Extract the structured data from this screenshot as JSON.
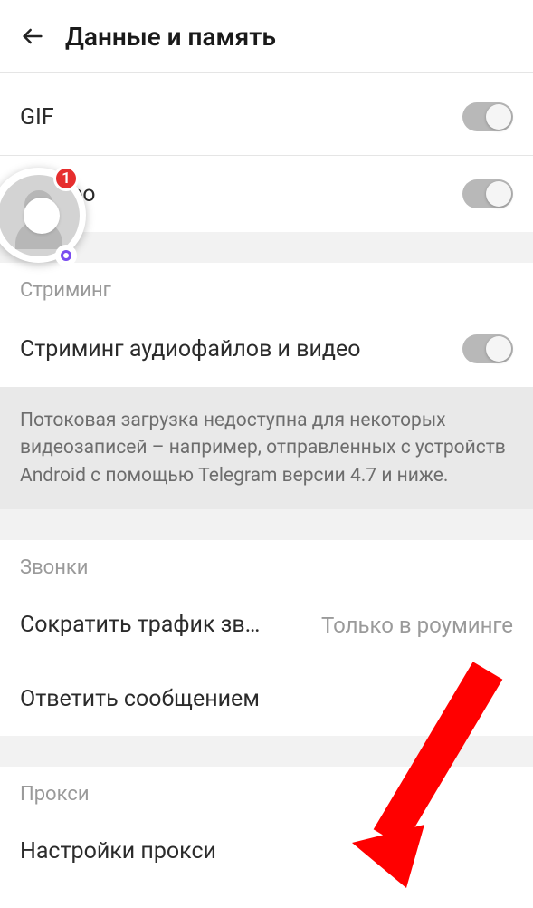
{
  "header": {
    "title": "Данные и память"
  },
  "autoplay": {
    "gif_label": "GIF",
    "video_label": "ео"
  },
  "streaming": {
    "section": "Стриминг",
    "toggle_label": "Стриминг аудиофайлов и видео",
    "info": "Потоковая загрузка недоступна для некоторых видеозаписей – например, отправленных с устройств Android с помощью Telegram версии 4.7 и ниже."
  },
  "calls": {
    "section": "Звонки",
    "reduce_label": "Сократить трафик зв…",
    "reduce_value": "Только в роуминге",
    "reply_label": "Ответить сообщением"
  },
  "proxy": {
    "section": "Прокси",
    "settings_label": "Настройки прокси"
  },
  "chathead": {
    "badge_count": "1"
  }
}
